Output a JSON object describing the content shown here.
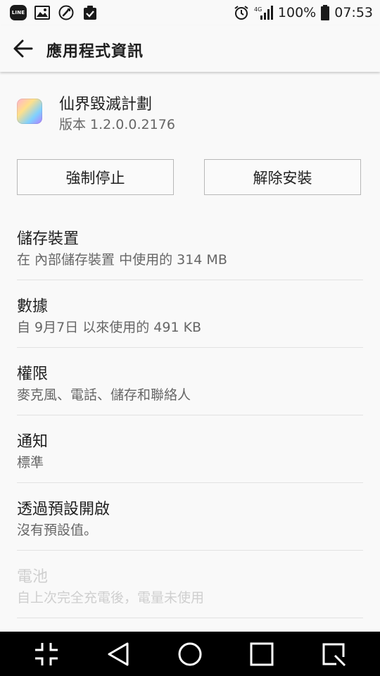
{
  "status_bar": {
    "line_label": "LINE",
    "network": "4G",
    "battery": "100%",
    "time": "07:53",
    "icons": [
      "line-icon",
      "gallery-icon",
      "missed-call-icon",
      "task-icon",
      "alarm-icon",
      "signal-icon",
      "battery-icon"
    ]
  },
  "app_bar": {
    "title": "應用程式資訊",
    "back_icon": "arrow-left-icon"
  },
  "app": {
    "name": "仙界毀滅計劃",
    "version": "版本 1.2.0.0.2176"
  },
  "buttons": {
    "force_stop": "強制停止",
    "uninstall": "解除安裝"
  },
  "items": [
    {
      "title": "儲存裝置",
      "subtitle": "在 內部儲存裝置 中使用的 314 MB",
      "enabled": true
    },
    {
      "title": "數據",
      "subtitle": "自 9月7日 以來使用的 491 KB",
      "enabled": true
    },
    {
      "title": "權限",
      "subtitle": "麥克風、電話、儲存和聯絡人",
      "enabled": true
    },
    {
      "title": "通知",
      "subtitle": "標準",
      "enabled": true
    },
    {
      "title": "透過預設開啟",
      "subtitle": "沒有預設值。",
      "enabled": true
    },
    {
      "title": "電池",
      "subtitle": "自上次完全充電後，電量未使用",
      "enabled": false
    }
  ],
  "nav_bar": {
    "icons": [
      "compress-icon",
      "back-triangle-icon",
      "home-circle-icon",
      "recents-square-icon",
      "qslide-icon"
    ]
  }
}
